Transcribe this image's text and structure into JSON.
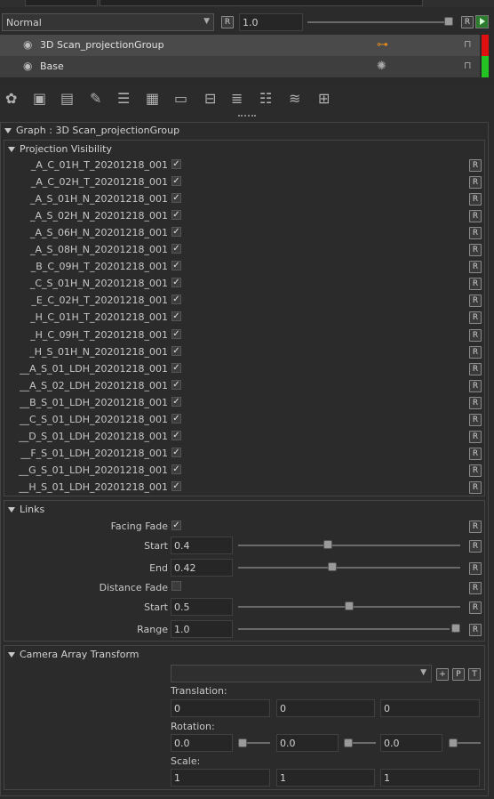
{
  "top": {
    "blend_mode": "Normal",
    "r_label": "R",
    "opacity": "1.0",
    "accent_green": "#2d9c2d",
    "accent_red": "#e01010"
  },
  "layers": [
    {
      "name": "3D Scan_projectionGroup",
      "icon": "hierarchy-icon",
      "color": "#e01010"
    },
    {
      "name": "Base",
      "icon": "palette-icon",
      "color": "#22c322"
    }
  ],
  "toolbar": {
    "icons": [
      "add-material-icon",
      "add-image-icon",
      "add-fill-icon",
      "add-brush-icon",
      "add-list-icon",
      "add-pattern-icon",
      "add-folder-icon",
      "align-icon",
      "list-icon",
      "remove-list-icon",
      "add-stack-icon",
      "grid-icon"
    ]
  },
  "graph": {
    "title": "Graph : 3D Scan_projectionGroup"
  },
  "projection": {
    "title": "Projection Visibility",
    "items": [
      "_A_C_01H_T_20201218_001",
      "_A_C_02H_T_20201218_001",
      "_A_S_01H_N_20201218_001",
      "_A_S_02H_N_20201218_001",
      "_A_S_06H_N_20201218_001",
      "_A_S_08H_N_20201218_001",
      "_B_C_09H_T_20201218_001",
      "_C_S_01H_N_20201218_001",
      "_E_C_02H_T_20201218_001",
      "_H_C_01H_T_20201218_001",
      "_H_C_09H_T_20201218_001",
      "_H_S_01H_N_20201218_001",
      "__A_S_01_LDH_20201218_001",
      "__A_S_02_LDH_20201218_001",
      "__B_S_01_LDH_20201218_001",
      "__C_S_01_LDH_20201218_001",
      "__D_S_01_LDH_20201218_001",
      "__F_S_01_LDH_20201218_001",
      "__G_S_01_LDH_20201218_001",
      "__H_S_01_LDH_20201218_001"
    ]
  },
  "links": {
    "title": "Links",
    "facing_fade_label": "Facing Fade",
    "start1_label": "Start",
    "start1_value": "0.4",
    "start1_level": 0.4,
    "end_label": "End",
    "end_value": "0.42",
    "end_level": 0.42,
    "distance_fade_label": "Distance Fade",
    "start2_label": "Start",
    "start2_value": "0.5",
    "start2_level": 0.5,
    "range_label": "Range",
    "range_value": "1.0",
    "range_level": 1.0
  },
  "camera": {
    "title": "Camera Array Transform",
    "plus": "+",
    "p": "P",
    "t": "T",
    "translation_label": "Translation:",
    "translation": [
      "0",
      "0",
      "0"
    ],
    "rotation_label": "Rotation:",
    "rotation": [
      "0.0",
      "0.0",
      "0.0"
    ],
    "scale_label": "Scale:",
    "scale": [
      "1",
      "1",
      "1"
    ]
  }
}
